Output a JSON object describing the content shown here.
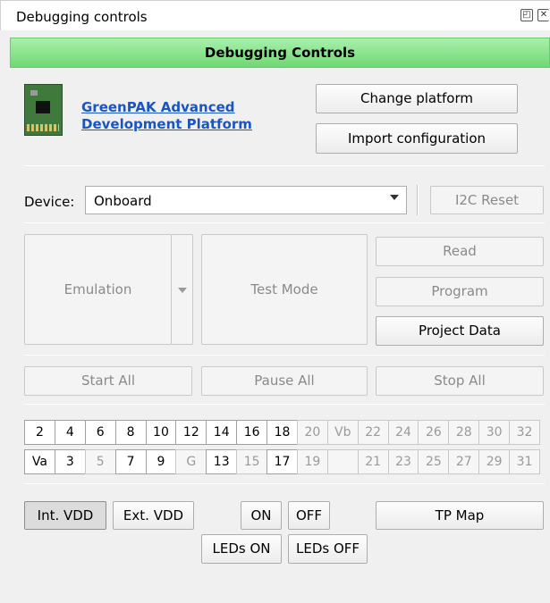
{
  "window": {
    "title": "Debugging controls"
  },
  "header": {
    "title": "Debugging Controls"
  },
  "platform": {
    "link_line1": "GreenPAK Advanced",
    "link_line2": "Development Platform",
    "change_label": "Change platform",
    "import_label": "Import configuration"
  },
  "device": {
    "label": "Device:",
    "value": "Onboard",
    "i2c_reset_label": "I2C Reset"
  },
  "modes": {
    "emulation_label": "Emulation",
    "test_mode_label": "Test Mode",
    "read_label": "Read",
    "program_label": "Program",
    "project_data_label": "Project Data"
  },
  "run": {
    "start_all": "Start All",
    "pause_all": "Pause All",
    "stop_all": "Stop All"
  },
  "pins": {
    "top_row": [
      "2",
      "4",
      "6",
      "8",
      "10",
      "12",
      "14",
      "16",
      "18",
      "20",
      "Vb",
      "22",
      "24",
      "26",
      "28",
      "30",
      "32"
    ],
    "bottom_row": [
      "Va",
      "3",
      "5",
      "7",
      "9",
      "G",
      "13",
      "15",
      "17",
      "19",
      "",
      "21",
      "23",
      "25",
      "27",
      "29",
      "31"
    ],
    "top_dim": [
      false,
      false,
      false,
      false,
      false,
      false,
      false,
      false,
      false,
      true,
      true,
      true,
      true,
      true,
      true,
      true,
      true
    ],
    "bottom_dim": [
      false,
      false,
      true,
      false,
      false,
      true,
      false,
      true,
      false,
      true,
      true,
      true,
      true,
      true,
      true,
      true,
      true
    ]
  },
  "power": {
    "int_vdd": "Int. VDD",
    "ext_vdd": "Ext. VDD",
    "on": "ON",
    "off": "OFF",
    "tp_map": "TP Map",
    "leds_on": "LEDs ON",
    "leds_off": "LEDs OFF"
  },
  "colors": {
    "header_green": "#86e28a",
    "link_blue": "#1a55c0"
  }
}
